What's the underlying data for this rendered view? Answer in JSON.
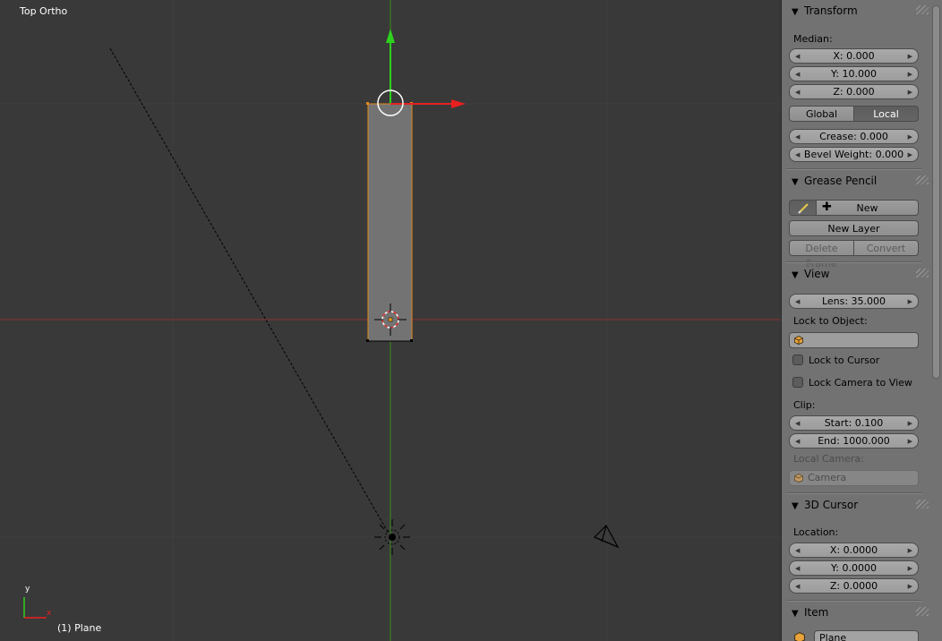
{
  "viewport": {
    "view_label": "Top Ortho",
    "object_label": "(1) Plane",
    "axis_y": "y",
    "axis_x": "x"
  },
  "transform": {
    "title": "Transform",
    "median_label": "Median:",
    "x": "X: 0.000",
    "y": "Y: 10.000",
    "z": "Z: 0.000",
    "global": "Global",
    "local": "Local",
    "crease": "Crease: 0.000",
    "bevel": "Bevel Weight: 0.000"
  },
  "grease_pencil": {
    "title": "Grease Pencil",
    "new": "New",
    "new_layer": "New Layer",
    "delete_frame": "Delete Frame",
    "convert": "Convert"
  },
  "view": {
    "title": "View",
    "lens": "Lens: 35.000",
    "lock_to_object": "Lock to Object:",
    "lock_to_cursor": "Lock to Cursor",
    "lock_camera": "Lock Camera to View",
    "clip": "Clip:",
    "start": "Start: 0.100",
    "end": "End: 1000.000",
    "local_camera": "Local Camera:",
    "camera": "Camera"
  },
  "cursor3d": {
    "title": "3D Cursor",
    "location": "Location:",
    "x": "X: 0.0000",
    "y": "Y: 0.0000",
    "z": "Z: 0.0000"
  },
  "item": {
    "title": "Item",
    "name": "Plane"
  }
}
